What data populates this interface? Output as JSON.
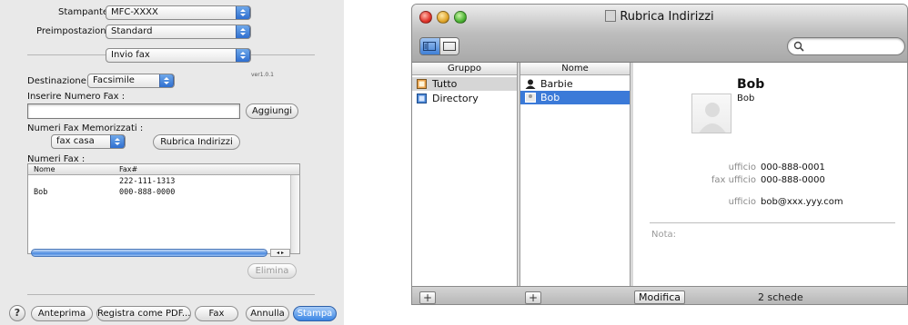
{
  "print_dialog": {
    "printer_label": "Stampante:",
    "printer_value": "MFC-XXXX",
    "presets_label": "Preimpostazioni:",
    "presets_value": "Standard",
    "panel_value": "Invio fax",
    "destination_label": "Destinazione :",
    "destination_value": "Facsimile",
    "version": "ver1.0.1",
    "enter_fax_label": "Inserire Numero Fax :",
    "fax_input_value": "",
    "add_button": "Aggiungi",
    "stored_fax_label": "Numeri Fax Memorizzati :",
    "stored_fax_value": "fax casa",
    "address_book_button": "Rubrica Indirizzi",
    "fax_numbers_label": "Numeri Fax :",
    "table": {
      "col_name": "Nome",
      "col_fax": "Fax#",
      "rows": [
        {
          "name": "",
          "fax": "222-111-1313"
        },
        {
          "name": "Bob",
          "fax": "000-888-0000"
        }
      ]
    },
    "delete_button": "Elimina",
    "help_glyph": "?",
    "footer_buttons": {
      "preview": "Anteprima",
      "save_pdf": "Registra come PDF...",
      "fax": "Fax",
      "cancel": "Annulla",
      "print": "Stampa"
    }
  },
  "address_book": {
    "title": "Rubrica Indirizzi",
    "group_header": "Gruppo",
    "name_header": "Nome",
    "groups": [
      "Tutto",
      "Directory"
    ],
    "names": [
      "Barbie",
      "Bob"
    ],
    "card": {
      "name": "Bob",
      "subname": "Bob",
      "fields": [
        {
          "label": "ufficio",
          "value": "000-888-0001"
        },
        {
          "label": "fax ufficio",
          "value": "000-888-0000"
        },
        {
          "label": "ufficio",
          "value": "bob@xxx.yyy.com"
        }
      ],
      "note_label": "Nota:"
    },
    "add_glyph": "+",
    "edit_button": "Modifica",
    "count_text": "2 schede"
  },
  "colors": {
    "accent_blue": "#3b7ad8",
    "default_button": "#3b86e4"
  }
}
